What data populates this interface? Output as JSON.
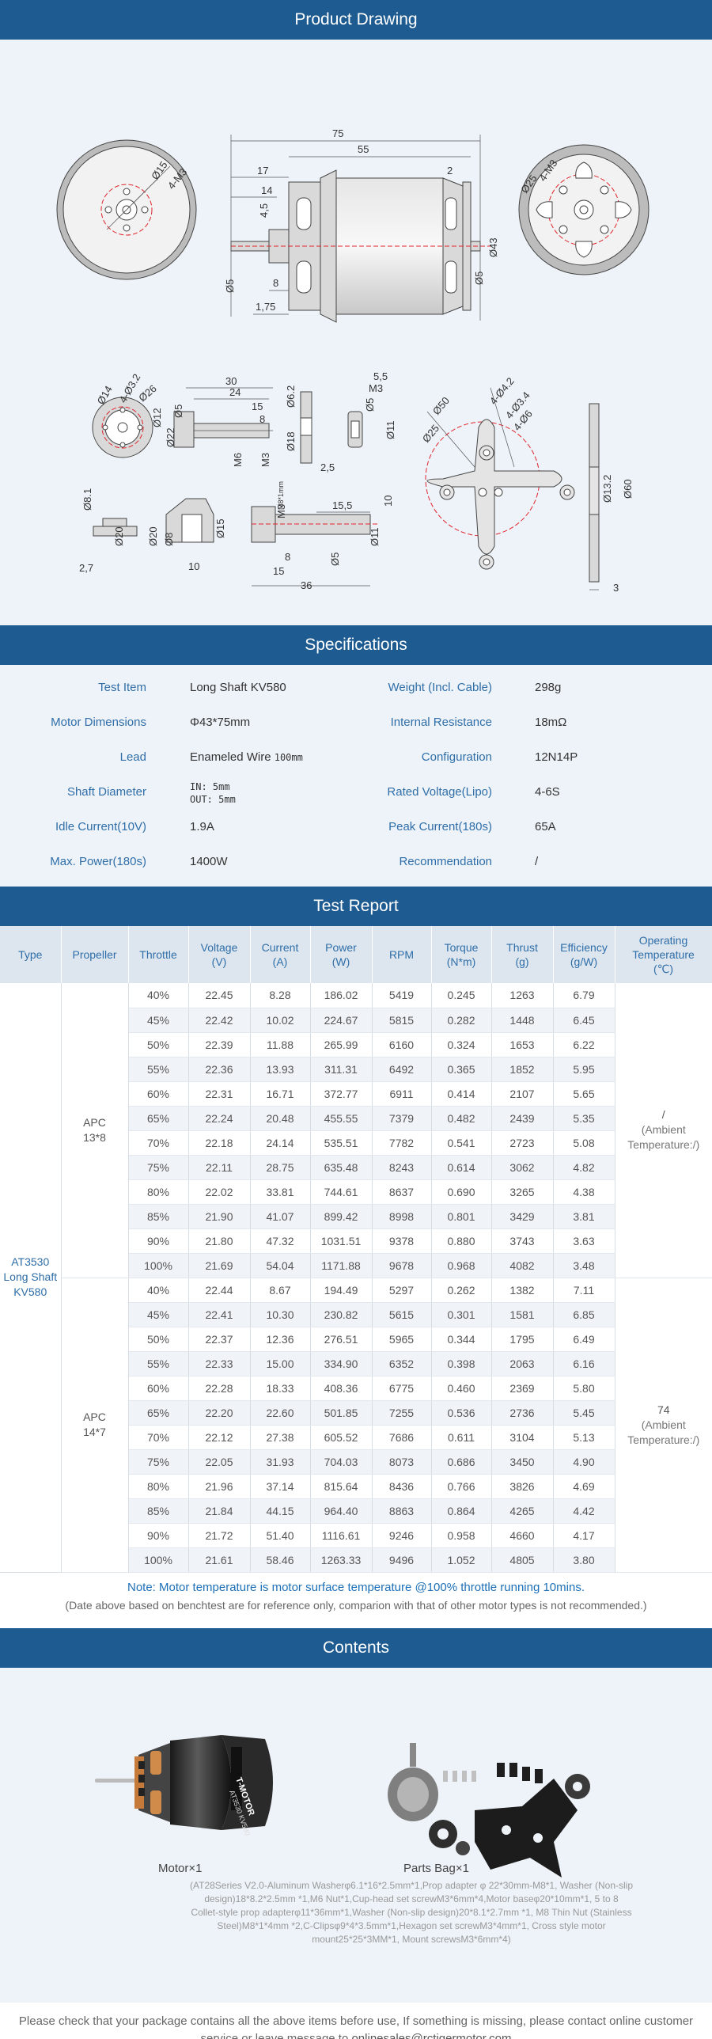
{
  "sections": {
    "drawing": "Product Drawing",
    "specs": "Specifications",
    "report": "Test Report",
    "contents": "Contents"
  },
  "drawing_dims": {
    "top": [
      "75",
      "55",
      "17",
      "14",
      "4.5",
      "2",
      "Ø15",
      "4-M3",
      "Ø25",
      "4-M3",
      "Ø5",
      "Ø43",
      "Ø5",
      "8",
      "1.75"
    ],
    "mid": [
      "30",
      "24",
      "15",
      "8",
      "Ø6.2",
      "5.5",
      "M3",
      "Ø5",
      "Ø11",
      "Ø12",
      "Ø22",
      "Ø5",
      "M6",
      "M3",
      "Ø18",
      "2.5",
      "Ø50",
      "Ø25",
      "4-Ø4.2",
      "4-Ø3.4",
      "4-Ø6",
      "10",
      "Ø13.2",
      "Ø60",
      "3"
    ],
    "bottom": [
      "Ø8.1",
      "Ø20",
      "2.7",
      "Ø8",
      "Ø20",
      "Ø15",
      "10",
      "M3",
      "M8*1mm",
      "15.5",
      "Ø11",
      "8",
      "15",
      "Ø5",
      "36"
    ],
    "circle_top_left": "Ø15",
    "m3_top_left": "4-M3"
  },
  "specs": [
    {
      "l_label": "Test Item",
      "l_value": "Long Shaft KV580",
      "r_label": "Weight (Incl. Cable)",
      "r_value": "298g"
    },
    {
      "l_label": "Motor Dimensions",
      "l_value": "Φ43*75mm",
      "r_label": "Internal Resistance",
      "r_value": "18mΩ"
    },
    {
      "l_label": "Lead",
      "l_value": "Enameled Wire",
      "l_extra": "100mm",
      "r_label": "Configuration",
      "r_value": "12N14P"
    },
    {
      "l_label": "Shaft Diameter",
      "l_in": "IN: 5mm",
      "l_out": "OUT: 5mm",
      "r_label": "Rated Voltage(Lipo)",
      "r_value": "4-6S"
    },
    {
      "l_label": "Idle Current(10V)",
      "l_value": "1.9A",
      "r_label": "Peak Current(180s)",
      "r_value": "65A"
    },
    {
      "l_label": "Max. Power(180s)",
      "l_value": "1400W",
      "r_label": "Recommendation",
      "r_value": "/"
    }
  ],
  "report": {
    "headers": [
      "Type",
      "Propeller",
      "Throttle",
      "Voltage\n(V)",
      "Current\n(A)",
      "Power\n(W)",
      "RPM",
      "Torque\n(N*m)",
      "Thrust\n(g)",
      "Efficiency\n(g/W)",
      "Operating\nTemperature\n(℃)"
    ],
    "type": "AT3530\nLong Shaft\nKV580",
    "groups": [
      {
        "propeller": "APC\n13*8",
        "temp": "/",
        "temp_sub": "(Ambient\nTemperature:/)",
        "rows": [
          [
            "40%",
            "22.45",
            "8.28",
            "186.02",
            "5419",
            "0.245",
            "1263",
            "6.79"
          ],
          [
            "45%",
            "22.42",
            "10.02",
            "224.67",
            "5815",
            "0.282",
            "1448",
            "6.45"
          ],
          [
            "50%",
            "22.39",
            "11.88",
            "265.99",
            "6160",
            "0.324",
            "1653",
            "6.22"
          ],
          [
            "55%",
            "22.36",
            "13.93",
            "311.31",
            "6492",
            "0.365",
            "1852",
            "5.95"
          ],
          [
            "60%",
            "22.31",
            "16.71",
            "372.77",
            "6911",
            "0.414",
            "2107",
            "5.65"
          ],
          [
            "65%",
            "22.24",
            "20.48",
            "455.55",
            "7379",
            "0.482",
            "2439",
            "5.35"
          ],
          [
            "70%",
            "22.18",
            "24.14",
            "535.51",
            "7782",
            "0.541",
            "2723",
            "5.08"
          ],
          [
            "75%",
            "22.11",
            "28.75",
            "635.48",
            "8243",
            "0.614",
            "3062",
            "4.82"
          ],
          [
            "80%",
            "22.02",
            "33.81",
            "744.61",
            "8637",
            "0.690",
            "3265",
            "4.38"
          ],
          [
            "85%",
            "21.90",
            "41.07",
            "899.42",
            "8998",
            "0.801",
            "3429",
            "3.81"
          ],
          [
            "90%",
            "21.80",
            "47.32",
            "1031.51",
            "9378",
            "0.880",
            "3743",
            "3.63"
          ],
          [
            "100%",
            "21.69",
            "54.04",
            "1171.88",
            "9678",
            "0.968",
            "4082",
            "3.48"
          ]
        ]
      },
      {
        "propeller": "APC\n14*7",
        "temp": "74",
        "temp_sub": "(Ambient\nTemperature:/)",
        "rows": [
          [
            "40%",
            "22.44",
            "8.67",
            "194.49",
            "5297",
            "0.262",
            "1382",
            "7.11"
          ],
          [
            "45%",
            "22.41",
            "10.30",
            "230.82",
            "5615",
            "0.301",
            "1581",
            "6.85"
          ],
          [
            "50%",
            "22.37",
            "12.36",
            "276.51",
            "5965",
            "0.344",
            "1795",
            "6.49"
          ],
          [
            "55%",
            "22.33",
            "15.00",
            "334.90",
            "6352",
            "0.398",
            "2063",
            "6.16"
          ],
          [
            "60%",
            "22.28",
            "18.33",
            "408.36",
            "6775",
            "0.460",
            "2369",
            "5.80"
          ],
          [
            "65%",
            "22.20",
            "22.60",
            "501.85",
            "7255",
            "0.536",
            "2736",
            "5.45"
          ],
          [
            "70%",
            "22.12",
            "27.38",
            "605.52",
            "7686",
            "0.611",
            "3104",
            "5.13"
          ],
          [
            "75%",
            "22.05",
            "31.93",
            "704.03",
            "8073",
            "0.686",
            "3450",
            "4.90"
          ],
          [
            "80%",
            "21.96",
            "37.14",
            "815.64",
            "8436",
            "0.766",
            "3826",
            "4.69"
          ],
          [
            "85%",
            "21.84",
            "44.15",
            "964.40",
            "8863",
            "0.864",
            "4265",
            "4.42"
          ],
          [
            "90%",
            "21.72",
            "51.40",
            "1116.61",
            "9246",
            "0.958",
            "4660",
            "4.17"
          ],
          [
            "100%",
            "21.61",
            "58.46",
            "1263.33",
            "9496",
            "1.052",
            "4805",
            "3.80"
          ]
        ]
      }
    ],
    "note1": "Note: Motor temperature is motor surface temperature @100% throttle running 10mins.",
    "note2": "(Date above based on benchtest are for reference only, comparion with that of other motor types is not recommended.)"
  },
  "contents": {
    "motor_label": "Motor×1",
    "bag_label": "Parts Bag×1",
    "motor_brand": "T-MOTOR",
    "motor_model": "AT3530 KV580",
    "bag_desc": "(AT28Series V2.0-Aluminum Washerφ6.1*16*2.5mm*1,Prop adapter φ 22*30mm-M8*1, Washer (Non-slip design)18*8.2*2.5mm *1,M6 Nut*1,Cup-head set screwM3*6mm*4,Motor baseφ20*10mm*1, 5 to 8 Collet-style prop adapterφ11*36mm*1,Washer (Non-slip design)20*8.1*2.7mm *1, M8 Thin Nut (Stainless Steel)M8*1*4mm *2,C-Clipsφ9*4*3.5mm*1,Hexagon set screwM3*4mm*1, Cross style motor mount25*25*3MM*1, Mount screwsM3*6mm*4)"
  },
  "footer": {
    "text": "Please check that your package contains all the above items before use, If something is missing, please contact online customer service or leave message to ",
    "email": "onlinesales@rctigermotor.com"
  },
  "colors": {
    "header_bg": "#1d5b91",
    "label_blue": "#2f6ea8",
    "panel_bg": "#eef3f9",
    "note_blue": "#1d6fb8"
  }
}
